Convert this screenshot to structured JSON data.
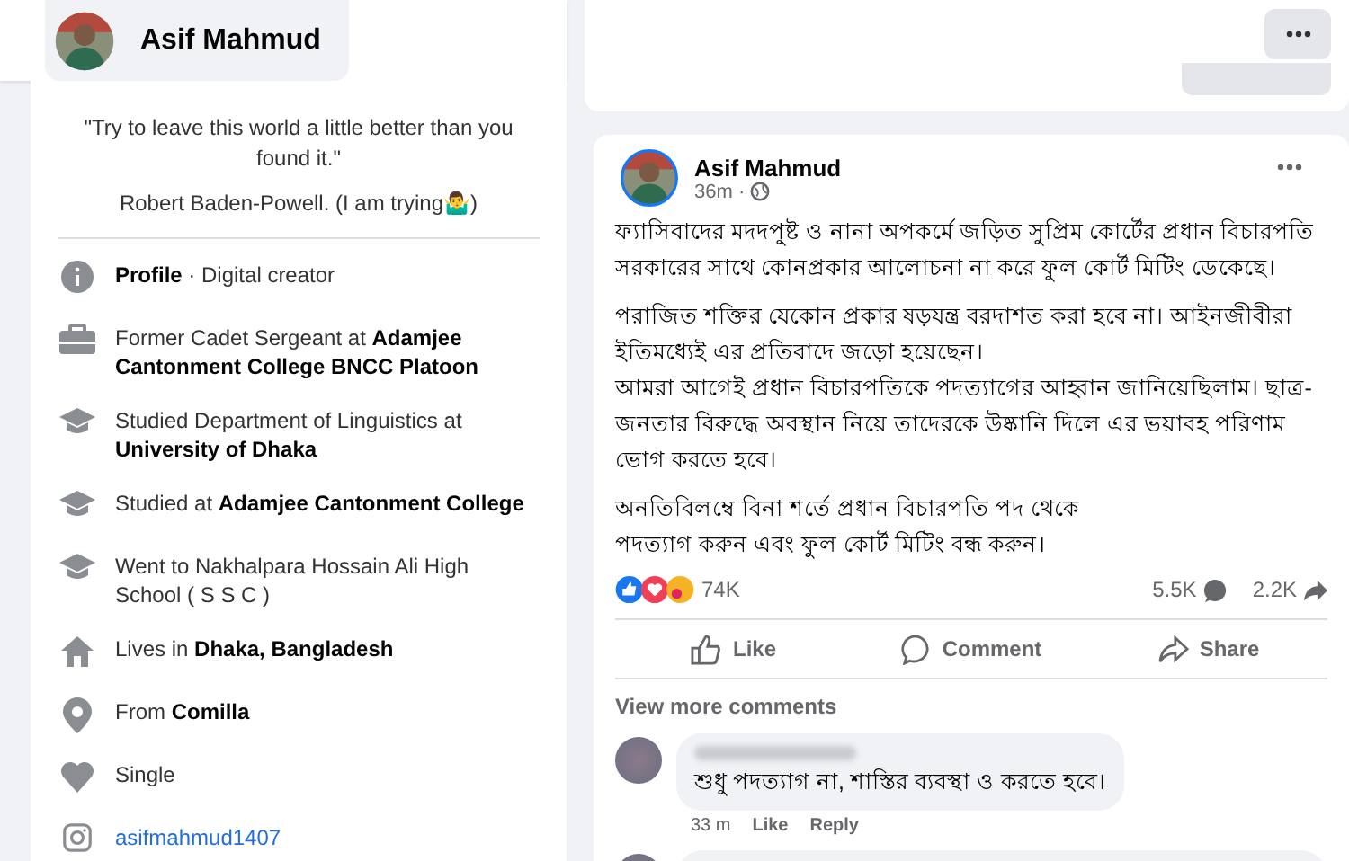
{
  "header": {
    "profile_name": "Asif Mahmud"
  },
  "intro": {
    "bio": [
      "\"Try to leave this world a little better than you found it.\"",
      "Robert Baden-Powell. (I am trying🤷‍♂️)"
    ],
    "items": [
      {
        "kind": "info",
        "text": "**Profile** · Digital creator"
      },
      {
        "kind": "work",
        "text": "Former Cadet Sergeant at **Adamjee Cantonment College BNCC Platoon**"
      },
      {
        "kind": "education",
        "text": "Studied Department of Linguistics at **University of Dhaka**"
      },
      {
        "kind": "education",
        "text": "Studied at **Adamjee Cantonment College**"
      },
      {
        "kind": "education",
        "text": "Went to Nakhalpara Hossain Ali High School ( S S C )"
      },
      {
        "kind": "home",
        "text": "Lives in **Dhaka, Bangladesh**"
      },
      {
        "kind": "location",
        "text": "From **Comilla**"
      },
      {
        "kind": "relationship",
        "text": "Single"
      },
      {
        "kind": "instagram",
        "text": "asifmahmud1407"
      }
    ]
  },
  "post": {
    "author": "Asif Mahmud",
    "time": "36m ·",
    "paragraphs": [
      "ফ্যাসিবাদের মদদপুষ্ট ও নানা অপকর্মে জড়িত সুপ্রিম কোর্টের প্রধান বিচারপতি সরকারের সাথে কোনপ্রকার আলোচনা না করে ফুল কোর্ট মিটিং ডেকেছে।",
      "পরাজিত শক্তির যেকোন প্রকার ষড়যন্ত্র বরদাশত করা হবে না। আইনজীবীরা ইতিমধ্যেই এর প্রতিবাদে জড়ো হয়েছেন।\nআমরা আগেই প্রধান বিচারপতিকে পদত্যাগের আহ্বান জানিয়েছিলাম। ছাত্র-জনতার বিরুদ্ধে অবস্থান নিয়ে তাদেরকে উষ্কানি দিলে এর ভয়াবহ পরিণাম ভোগ করতে হবে।",
      "অনতিবিলম্বে বিনা শর্তে প্রধান বিচারপতি পদ থেকে\nপদত্যাগ করুন এবং ফুল কোর্ট মিটিং বন্ধ করুন।"
    ],
    "reactions": "74K",
    "comments_count": "5.5K",
    "shares_count": "2.2K",
    "actions": [
      {
        "kind": "like",
        "label": "Like"
      },
      {
        "kind": "comment",
        "label": "Comment"
      },
      {
        "kind": "share",
        "label": "Share"
      }
    ],
    "view_more": "View more comments",
    "comments": [
      {
        "text": "শুধু পদত্যাগ না, শাস্তির ব্যবস্থা ও করতে হবে।",
        "time": "33 m",
        "like": "Like",
        "reply": "Reply"
      }
    ]
  }
}
